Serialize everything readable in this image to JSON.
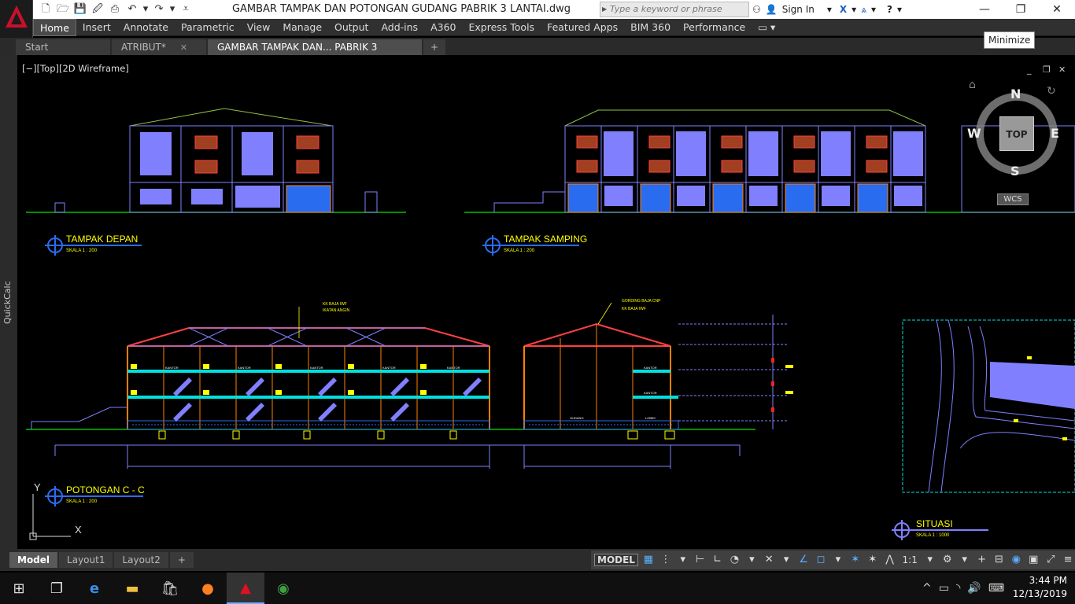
{
  "window": {
    "title": "GAMBAR TAMPAK DAN POTONGAN GUDANG PABRIK 3 LANTAI.dwg",
    "search_placeholder": "Type a keyword or phrase",
    "sign_in": "Sign In",
    "tooltip": "Minimize"
  },
  "ribbon": {
    "tabs": [
      "Home",
      "Insert",
      "Annotate",
      "Parametric",
      "View",
      "Manage",
      "Output",
      "Add-ins",
      "A360",
      "Express Tools",
      "Featured Apps",
      "BIM 360",
      "Performance"
    ],
    "active": "Home"
  },
  "document_tabs": {
    "tabs": [
      {
        "label": "Start"
      },
      {
        "label": "ATRIBUT*"
      },
      {
        "label": "GAMBAR TAMPAK DAN... PABRIK 3 LANTAI*"
      }
    ]
  },
  "sidebar": {
    "quickcalc": "QuickCalc"
  },
  "viewport": {
    "label": "[−][Top][2D Wireframe]",
    "viewcube": {
      "north": "N",
      "south": "S",
      "east": "E",
      "west": "W",
      "face": "TOP",
      "wcs": "WCS"
    },
    "ucs_y": "Y",
    "ucs_x": "X"
  },
  "drawing": {
    "views": [
      {
        "title": "TAMPAK DEPAN",
        "scale": "SKALA     1 : 200"
      },
      {
        "title": "TAMPAK SAMPING",
        "scale": "SKALA     1 : 200"
      },
      {
        "title": "POTONGAN C - C",
        "scale": "SKALA     1 : 200"
      },
      {
        "title": "SITUASI",
        "scale": "SKALA     1 : 1000"
      }
    ],
    "section_notes": {
      "note1": "KK BAJA IWF",
      "note2": "IKATAN ANGIN",
      "note3": "GORDING BAJA CNP",
      "note4": "KK BAJA IWF",
      "room_kantor": "KANTOR",
      "room_gudang": "GUDANG",
      "room_lobby": "LOBBY"
    }
  },
  "layout_tabs": {
    "tabs": [
      "Model",
      "Layout1",
      "Layout2"
    ],
    "active": "Model"
  },
  "status": {
    "model": "MODEL",
    "scale": "1:1"
  },
  "taskbar": {
    "time": "3:44 PM",
    "date": "12/13/2019"
  },
  "colors": {
    "accent": "#2a6cf0",
    "wall": "#8080ff",
    "ground": "#00c000",
    "cyan": "#00e0e0",
    "yellow": "#ffff00",
    "red": "#ff2020",
    "orange": "#ff8000",
    "brown": "#a04020"
  }
}
